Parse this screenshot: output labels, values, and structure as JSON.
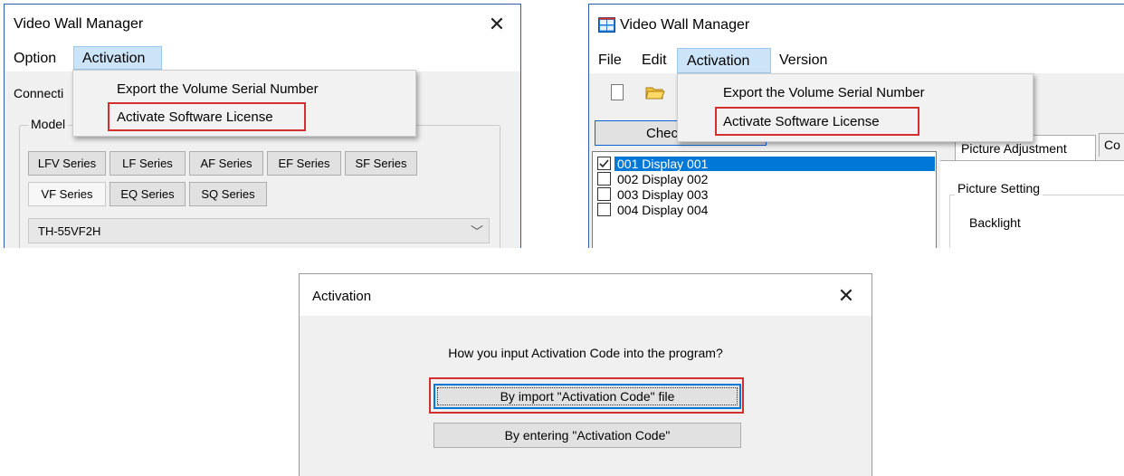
{
  "window_a": {
    "title": "Video Wall Manager",
    "close_glyph": "✕",
    "menu": {
      "option": "Option",
      "activation": "Activation"
    },
    "dropdown": [
      "Export the Volume Serial Number",
      "Activate Software License"
    ],
    "connection_label_partial": "Connecti",
    "model_group_label": "Model",
    "series_buttons": [
      "LFV Series",
      "LF Series",
      "AF Series",
      "EF Series",
      "SF Series",
      "VF Series",
      "EQ Series",
      "SQ Series"
    ],
    "selected_series": "VF Series",
    "model_select_value": "TH-55VF2H"
  },
  "window_b": {
    "title": "Video Wall Manager",
    "app_icon": "grid-app-icon",
    "menu": {
      "file": "File",
      "edit": "Edit",
      "activation": "Activation",
      "version": "Version"
    },
    "toolbar_icons": [
      "new-file-icon",
      "open-folder-icon"
    ],
    "dropdown": [
      "Export the Volume Serial Number",
      "Activate Software License"
    ],
    "check_button_partial": "Chec",
    "displays": [
      {
        "label": "001 Display 001",
        "checked": true,
        "selected": true
      },
      {
        "label": "002 Display 002",
        "checked": false,
        "selected": false
      },
      {
        "label": "003 Display 003",
        "checked": false,
        "selected": false
      },
      {
        "label": "004 Display 004",
        "checked": false,
        "selected": false
      }
    ],
    "tabs": [
      "Picture Adjustment",
      "Co"
    ],
    "group_label": "Picture Setting",
    "setting_label": "Backlight"
  },
  "dialog": {
    "title": "Activation",
    "close_glyph": "✕",
    "question": "How you input Activation Code into the program?",
    "button_import": "By import \"Activation Code\" file",
    "button_enter": "By entering \"Activation Code\""
  },
  "colors": {
    "highlight_box": "#d32f2f",
    "menu_hover": "#cce4f7",
    "selection": "#0078d7"
  }
}
